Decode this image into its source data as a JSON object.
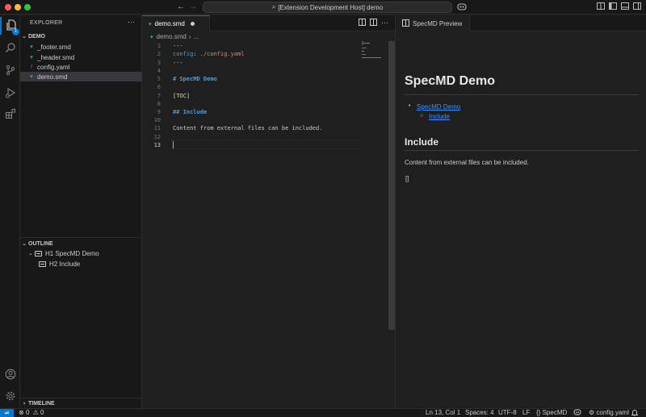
{
  "window": {
    "command_center": "[Extension Development Host] demo"
  },
  "activity_bar": {
    "explorer_badge": "1"
  },
  "sidebar": {
    "title": "EXPLORER",
    "more": "···",
    "folder": "DEMO",
    "files": [
      {
        "name": "_footer.smd",
        "icon": "markdown-icon"
      },
      {
        "name": "_header.smd",
        "icon": "markdown-icon"
      },
      {
        "name": "config.yaml",
        "icon": "yaml-icon"
      },
      {
        "name": "demo.smd",
        "icon": "markdown-icon",
        "selected": true
      }
    ],
    "outline": {
      "title": "OUTLINE",
      "items": [
        "H1 SpecMD Demo",
        "H2 Include"
      ]
    },
    "timeline": "TIMELINE"
  },
  "editor": {
    "tab_label": "demo.smd",
    "breadcrumb": {
      "file": "demo.smd",
      "sep": "›",
      "rest": "..."
    },
    "line_numbers": [
      "1",
      "2",
      "3",
      "4",
      "5",
      "6",
      "7",
      "8",
      "9",
      "10",
      "11",
      "12",
      "13"
    ],
    "current_line": "13",
    "lines": {
      "l1": "---",
      "l2_key": "config",
      "l2_colon": ": ",
      "l2_val": "./config.yaml",
      "l3": "---",
      "l5": "# SpecMD Demo",
      "l7": "[TOC]",
      "l9": "## Include",
      "l11": "Content from external files can be included."
    }
  },
  "preview": {
    "tab_label": "SpecMD Preview",
    "h1": "SpecMD Demo",
    "toc": [
      "SpecMD Demo",
      "Include"
    ],
    "h2": "Include",
    "paragraph": "Content from external files can be included.",
    "bracket": "[]"
  },
  "statusbar": {
    "errors": "0",
    "warnings": "0",
    "position": "Ln 13, Col 1",
    "spaces": "Spaces: 4",
    "encoding": "UTF-8",
    "eol": "LF",
    "language": "SpecMD",
    "config": "config.yaml"
  },
  "colors": {
    "accent": "#0078d4",
    "link": "#3794ff",
    "heading_keyword": "#569cd6",
    "string": "#ce9178"
  }
}
